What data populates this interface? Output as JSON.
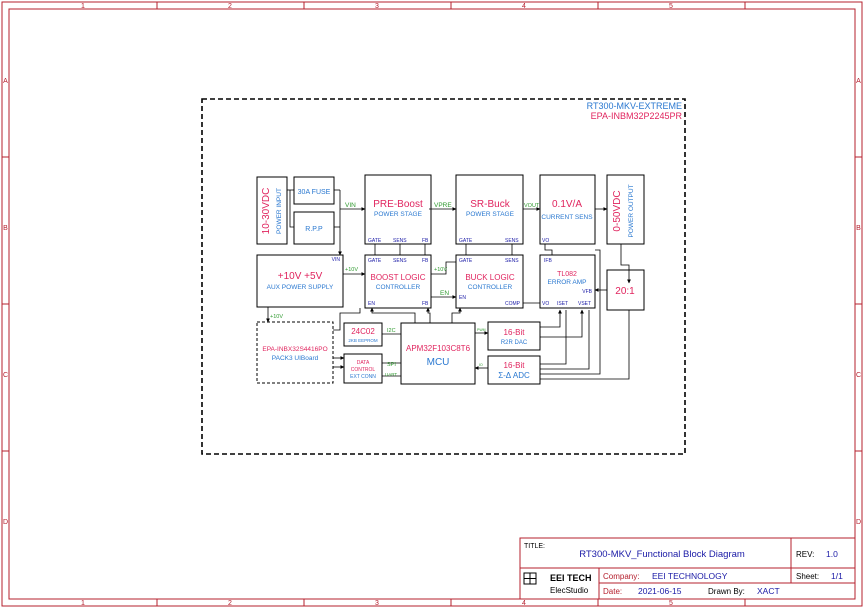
{
  "frame": {
    "columns": [
      "1",
      "2",
      "3",
      "4",
      "5"
    ],
    "rows": [
      "A",
      "B",
      "C",
      "D"
    ]
  },
  "header": {
    "line1": "RT300-MKV-EXTREME",
    "line2": "EPA-INBM32P2245PR"
  },
  "blocks": {
    "power_input": {
      "value": "10-30VDC",
      "label": "POWER INPUT"
    },
    "fuse": "30A FUSE",
    "rpp": "R.P.P",
    "pre_boost": {
      "title": "PRE-Boost",
      "subtitle": "POWER STAGE"
    },
    "sr_buck": {
      "title": "SR-Buck",
      "subtitle": "POWER STAGE"
    },
    "current_sens": {
      "title": "0.1V/A",
      "subtitle": "CURRENT SENS"
    },
    "power_output": {
      "value": "0-50VDC",
      "label": "POWER OUTPUT"
    },
    "aux_supply": {
      "title": "+10V +5V",
      "subtitle": "AUX POWER SUPPLY",
      "pin": "VIN"
    },
    "boost_logic": {
      "title": "BOOST LOGIC",
      "subtitle": "CONTROLLER"
    },
    "buck_logic": {
      "title": "BUCK LOGIC",
      "subtitle": "CONTROLLER"
    },
    "error_amp": {
      "title": "TL082",
      "subtitle": "ERROR AMP"
    },
    "divider": "20:1",
    "ui_board": {
      "title": "EPA-INBX32S4416PO",
      "subtitle": "PACK3 UIBoard"
    },
    "eeprom": {
      "title": "24C02",
      "subtitle": "2KB EEPROM"
    },
    "data_conn": {
      "line1": "DATA",
      "line2": "CONTROL",
      "line3": "EXT CONN"
    },
    "mcu": {
      "title": "APM32F103C8T6",
      "subtitle": "MCU"
    },
    "dac": {
      "title": "16-Bit",
      "subtitle": "R2R DAC"
    },
    "adc": {
      "title": "16-Bit",
      "subtitle": "Σ-Δ ADC"
    }
  },
  "pins": {
    "gate": "GATE",
    "sens": "SENS",
    "fb": "FB",
    "en": "EN",
    "comp": "COMP",
    "vo": "VO",
    "ifb": "IFB",
    "vfb": "VFB",
    "iset": "ISET",
    "vset": "VSET"
  },
  "signals": {
    "vin": "VIN",
    "vpre": "VPRE",
    "vout": "VOUT",
    "plus10v": "+10V",
    "en": "EN",
    "i2c": "I2C",
    "spi": "SPI",
    "uart": "UART",
    "pwm": "PWM",
    "io": "IO"
  },
  "title_block": {
    "title_label": "TITLE:",
    "title": "RT300-MKV_Functional Block Diagram",
    "rev_label": "REV:",
    "rev": "1.0",
    "logo_line1": "EEI TECH",
    "logo_line2": "ElecStudio",
    "company_label": "Company:",
    "company": "EEI TECHNOLOGY",
    "sheet_label": "Sheet:",
    "sheet": "1/1",
    "date_label": "Date:",
    "date": "2021-06-15",
    "drawn_label": "Drawn By:",
    "drawn": "XACT"
  },
  "colors": {
    "frame": "#b5202e",
    "line": "#000000",
    "blue": "#2a78d0",
    "pink": "#e0245e",
    "green": "#2f9a2f",
    "navy": "#1a1aa6"
  }
}
